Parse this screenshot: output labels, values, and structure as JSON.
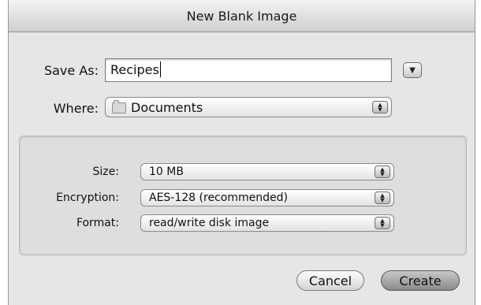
{
  "dialog": {
    "title": "New Blank Image"
  },
  "save_as": {
    "label": "Save As:",
    "value": "Recipes",
    "disclosure_icon": "triangle-down-icon"
  },
  "where": {
    "label": "Where:",
    "value": "Documents",
    "folder_icon": "folder-icon"
  },
  "options": {
    "size": {
      "label": "Size:",
      "value": "10 MB"
    },
    "encryption": {
      "label": "Encryption:",
      "value": "AES-128 (recommended)"
    },
    "format": {
      "label": "Format:",
      "value": "read/write disk image"
    }
  },
  "buttons": {
    "cancel": "Cancel",
    "create": "Create"
  }
}
